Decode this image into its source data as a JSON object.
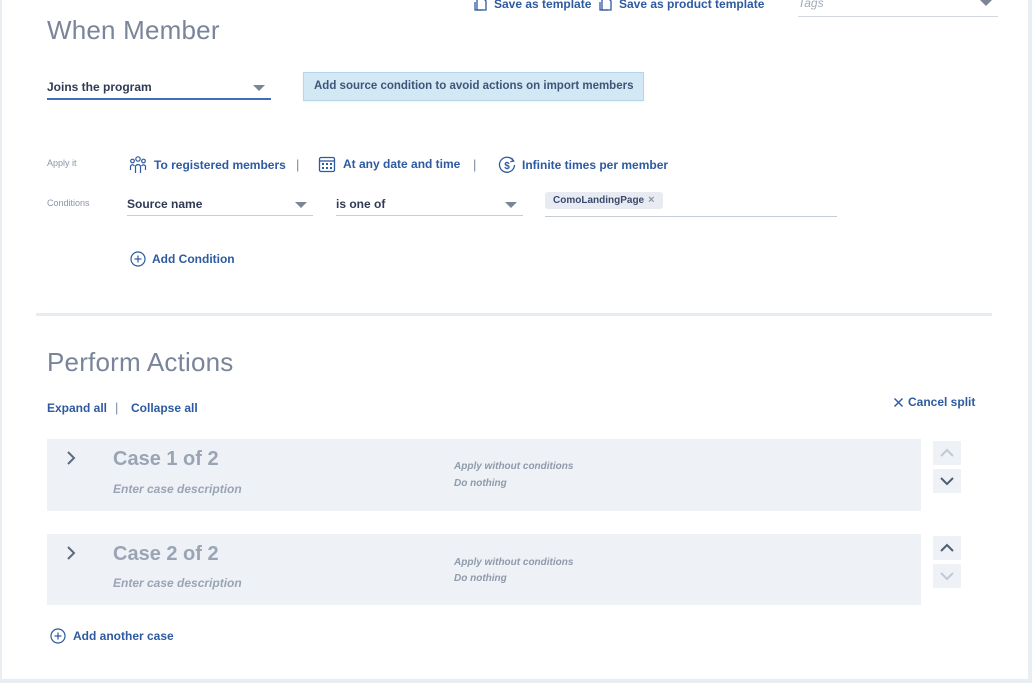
{
  "header": {
    "save_template": "Save as template",
    "save_product_template": "Save as product template",
    "tags_placeholder": "Tags"
  },
  "when": {
    "title": "When Member",
    "trigger_value": "Joins the program",
    "tip": "Add source condition to avoid actions on import members",
    "apply_label": "Apply it",
    "apply_registered": "To registered members",
    "apply_date": "At any date and time",
    "apply_times": "Infinite times per member",
    "separator": "|",
    "conditions_label": "Conditions",
    "condition_field": "Source name",
    "condition_operator": "is one of",
    "condition_chip": "ComoLandingPage",
    "chip_remove": "×",
    "add_condition": "Add Condition"
  },
  "actions": {
    "title": "Perform Actions",
    "expand_all": "Expand all",
    "separator": "|",
    "collapse_all": "Collapse all",
    "cancel_split": "Cancel split",
    "cases": [
      {
        "title": "Case 1 of 2",
        "description_placeholder": "Enter case description",
        "meta_condition": "Apply without conditions",
        "meta_action": "Do nothing"
      },
      {
        "title": "Case 2 of 2",
        "description_placeholder": "Enter case description",
        "meta_condition": "Apply without conditions",
        "meta_action": "Do nothing"
      }
    ],
    "add_case": "Add another case"
  },
  "colors": {
    "accent": "#2d5aa0",
    "heading": "#7a859a",
    "tip_bg": "#d3e8f5",
    "card_bg": "#eef2f6"
  }
}
